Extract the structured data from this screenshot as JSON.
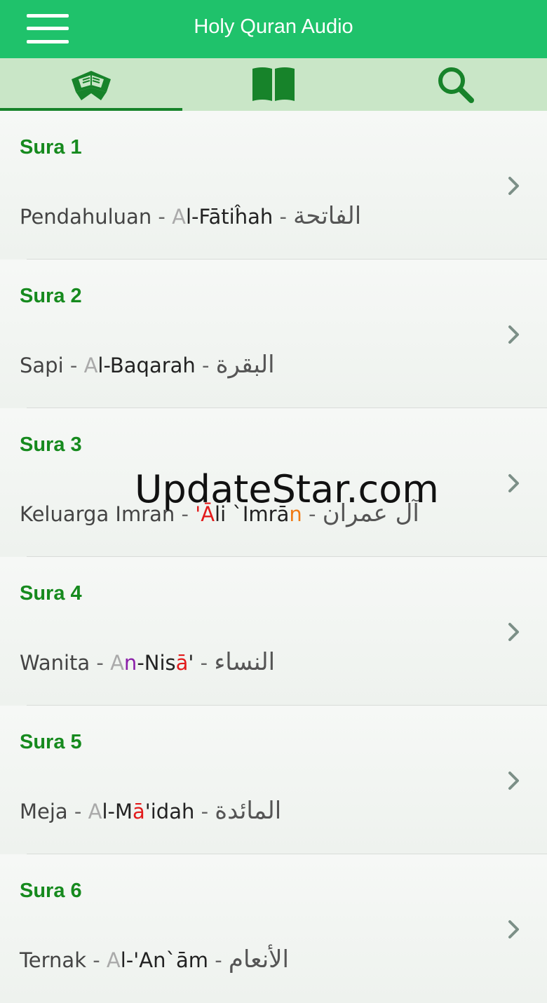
{
  "header": {
    "title": "Holy Quran Audio",
    "menu_icon": "hamburger-menu-icon"
  },
  "tabs": [
    {
      "icon": "open-quran-icon",
      "active": true
    },
    {
      "icon": "open-book-icon",
      "active": false
    },
    {
      "icon": "search-icon",
      "active": false
    }
  ],
  "colors": {
    "header": "#1fc26b",
    "tabbar": "#c9e6c7",
    "sura_label": "#168a1e",
    "indicator": "#17832a"
  },
  "suras": [
    {
      "label": "Sura 1",
      "translation": "Pendahuluan",
      "t": [
        "A",
        "l-Fātiĥah"
      ],
      "arabic": "الفاتحة"
    },
    {
      "label": "Sura 2",
      "translation": "Sapi",
      "t": [
        "A",
        "l-Baqarah"
      ],
      "arabic": "البقرة"
    },
    {
      "label": "Sura 3",
      "translation": "Keluarga Imran",
      "t": [
        "'",
        "Ā",
        "li `Imrā",
        "n"
      ],
      "arabic": "آل عمران"
    },
    {
      "label": "Sura 4",
      "translation": "Wanita",
      "t": [
        "A",
        "n",
        "-Nis",
        "ā",
        "'"
      ],
      "arabic": "النساء"
    },
    {
      "label": "Sura 5",
      "translation": "Meja",
      "t": [
        "A",
        "l-M",
        "ā",
        "'idah"
      ],
      "arabic": "المائدة"
    },
    {
      "label": "Sura 6",
      "translation": "Ternak",
      "t": [
        "A",
        "l-'An`ām"
      ],
      "arabic": "الأنعام"
    }
  ],
  "separator": " - ",
  "watermark": "UpdateStar.com",
  "row_icon": "chevron-right-icon"
}
